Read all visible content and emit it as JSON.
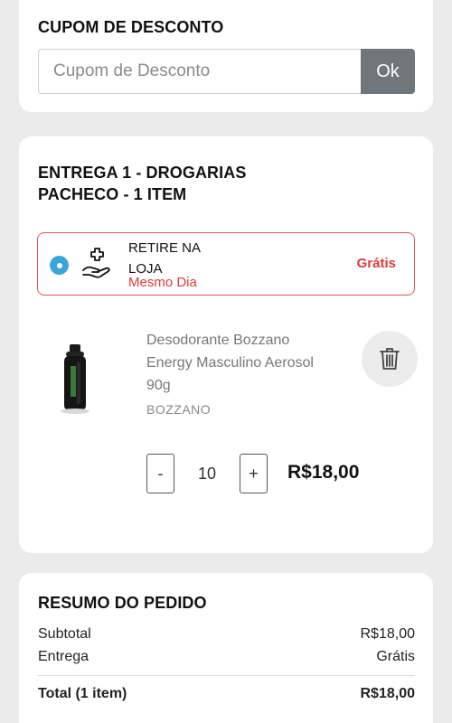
{
  "coupon": {
    "title": "CUPOM DE DESCONTO",
    "placeholder": "Cupom de Desconto",
    "button_label": "Ok"
  },
  "delivery": {
    "title": "ENTREGA 1 - DROGARIAS PACHECO - 1 ITEM",
    "option": {
      "label": "RETIRE NA LOJA",
      "sublabel": "Mesmo Dia",
      "price": "Grátis",
      "selected": true,
      "icon": "hand-with-cross-icon"
    }
  },
  "product": {
    "name": "Desodorante Bozzano Energy Masculino Aerosol 90g",
    "brand": "BOZZANO",
    "quantity": "10",
    "minus_label": "-",
    "plus_label": "+",
    "total": "R$18,00",
    "delete_icon": "trash-icon"
  },
  "summary": {
    "title": "RESUMO DO PEDIDO",
    "subtotal_label": "Subtotal",
    "subtotal_value": "R$18,00",
    "delivery_label": "Entrega",
    "delivery_value": "Grátis",
    "total_label": "Total (1 item)",
    "total_value": "R$18,00"
  },
  "colors": {
    "accent_red": "#e0393e",
    "radio_blue": "#3aa6d8",
    "ok_button": "#6f767c"
  }
}
